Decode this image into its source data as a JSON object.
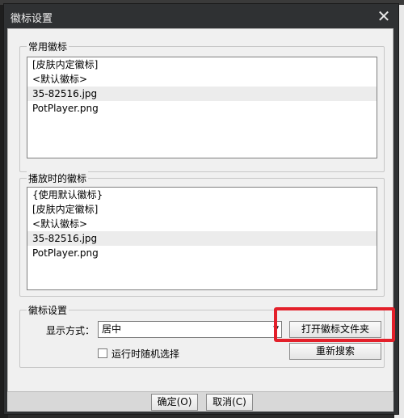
{
  "window": {
    "title": "徽标设置"
  },
  "common_group": {
    "label": "常用徽标",
    "items": [
      "[皮肤内定徽标]",
      "<默认徽标>",
      "35-82516.jpg",
      "PotPlayer.png"
    ],
    "selected_index": 2
  },
  "play_group": {
    "label": "播放时的徽标",
    "items": [
      "{使用默认徽标}",
      "[皮肤内定徽标]",
      "<默认徽标>",
      "35-82516.jpg",
      "PotPlayer.png"
    ],
    "selected_index": 3
  },
  "settings_group": {
    "label": "徽标设置",
    "display_label": "显示方式：",
    "display_value": "居中",
    "open_folder_button": "打开徽标文件夹",
    "research_button": "重新搜索",
    "random_checkbox": "运行时随机选择"
  },
  "footer": {
    "ok_button": "确定(O)",
    "cancel_button": "取消(C)"
  },
  "colors": {
    "highlight": "#e3202a",
    "titlebar": "#2f3133"
  },
  "icons": {
    "close": "close-icon",
    "dropdown": "chevron-down-icon"
  }
}
